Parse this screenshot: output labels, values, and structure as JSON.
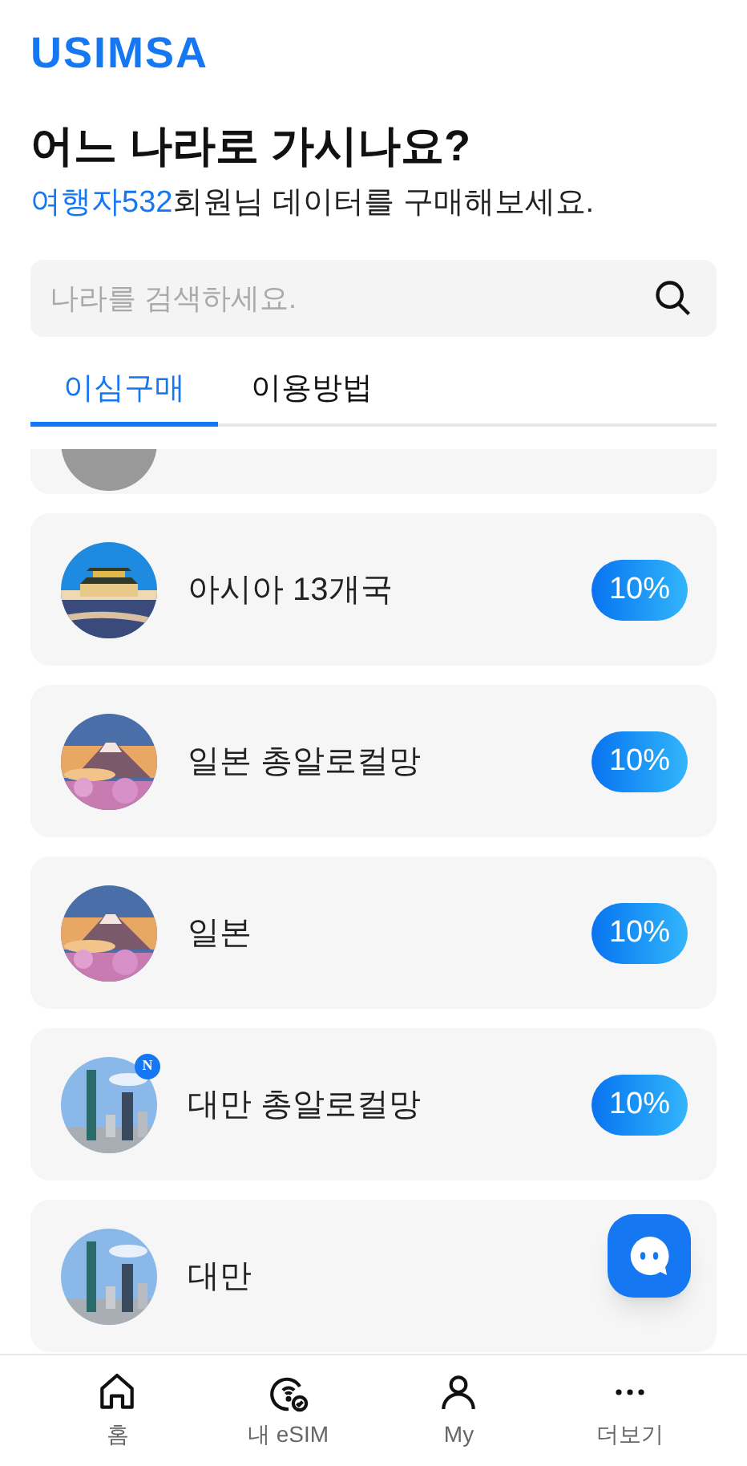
{
  "logo": "USIMSA",
  "title": "어느 나라로 가시나요?",
  "subtitle": {
    "user": "여행자532",
    "text": "회원님 데이터를 구매해보세요."
  },
  "search": {
    "placeholder": "나라를 검색하세요."
  },
  "tabs": [
    {
      "label": "이심구매",
      "selected": true
    },
    {
      "label": "이용방법",
      "selected": false
    }
  ],
  "products": [
    {
      "name": "아시아 13개국",
      "discount": "10%"
    },
    {
      "name": "일본 총알로컬망",
      "discount": "10%"
    },
    {
      "name": "일본",
      "discount": "10%"
    },
    {
      "name": "대만 총알로컬망",
      "discount": "10%",
      "badge": "N"
    },
    {
      "name": "대만"
    }
  ],
  "nav": [
    {
      "label": "홈",
      "kind": "home"
    },
    {
      "label": "내 eSIM",
      "kind": "esim"
    },
    {
      "label": "My",
      "kind": "user"
    },
    {
      "label": "더보기",
      "kind": "more"
    }
  ]
}
